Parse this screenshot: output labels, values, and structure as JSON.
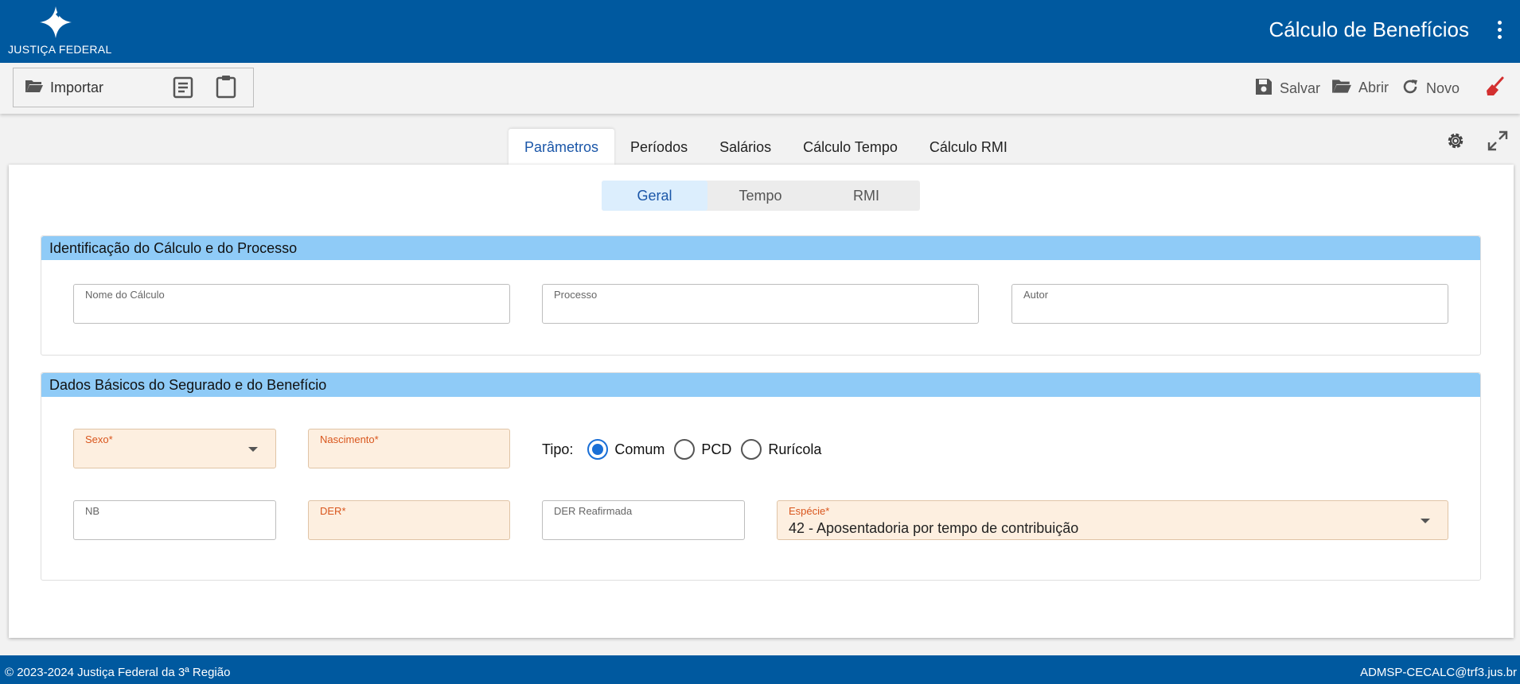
{
  "header": {
    "logo_text": "JUSTIÇA FEDERAL",
    "title": "Cálculo de Benefícios",
    "menu_icon": "kebab-menu-icon"
  },
  "toolbar": {
    "import_label": "Importar",
    "save_label": "Salvar",
    "open_label": "Abrir",
    "new_label": "Novo"
  },
  "tabs": [
    {
      "label": "Parâmetros",
      "active": true
    },
    {
      "label": "Períodos",
      "active": false
    },
    {
      "label": "Salários",
      "active": false
    },
    {
      "label": "Cálculo Tempo",
      "active": false
    },
    {
      "label": "Cálculo RMI",
      "active": false
    }
  ],
  "subtabs": [
    {
      "label": "Geral",
      "active": true
    },
    {
      "label": "Tempo",
      "active": false
    },
    {
      "label": "RMI",
      "active": false
    }
  ],
  "section1": {
    "title": "Identificação do Cálculo e do Processo",
    "fields": {
      "nome": {
        "label": "Nome do Cálculo",
        "value": ""
      },
      "processo": {
        "label": "Processo",
        "value": ""
      },
      "autor": {
        "label": "Autor",
        "value": ""
      }
    }
  },
  "section2": {
    "title": "Dados Básicos do Segurado e do Benefício",
    "sexo": {
      "label": "Sexo*",
      "value": ""
    },
    "nascimento": {
      "label": "Nascimento*",
      "value": ""
    },
    "tipo": {
      "label": "Tipo:",
      "options": [
        "Comum",
        "PCD",
        "Rurícola"
      ],
      "selected": "Comum"
    },
    "nb": {
      "label": "NB",
      "value": ""
    },
    "der": {
      "label": "DER*",
      "value": ""
    },
    "der_reafirmada": {
      "label": "DER Reafirmada",
      "value": ""
    },
    "especie": {
      "label": "Espécie*",
      "value": "42 - Aposentadoria por tempo de contribuição"
    }
  },
  "footer": {
    "copyright": "© 2023-2024 Justiça Federal da 3ª Região",
    "email": "ADMSP-CECALC@trf3.jus.br"
  },
  "colors": {
    "header_bg": "#00599f",
    "section_head_bg": "#8fcbf7",
    "required_field_bg": "#fdefe0",
    "accent": "#1a56a8",
    "clear_icon": "#d32f2f"
  }
}
